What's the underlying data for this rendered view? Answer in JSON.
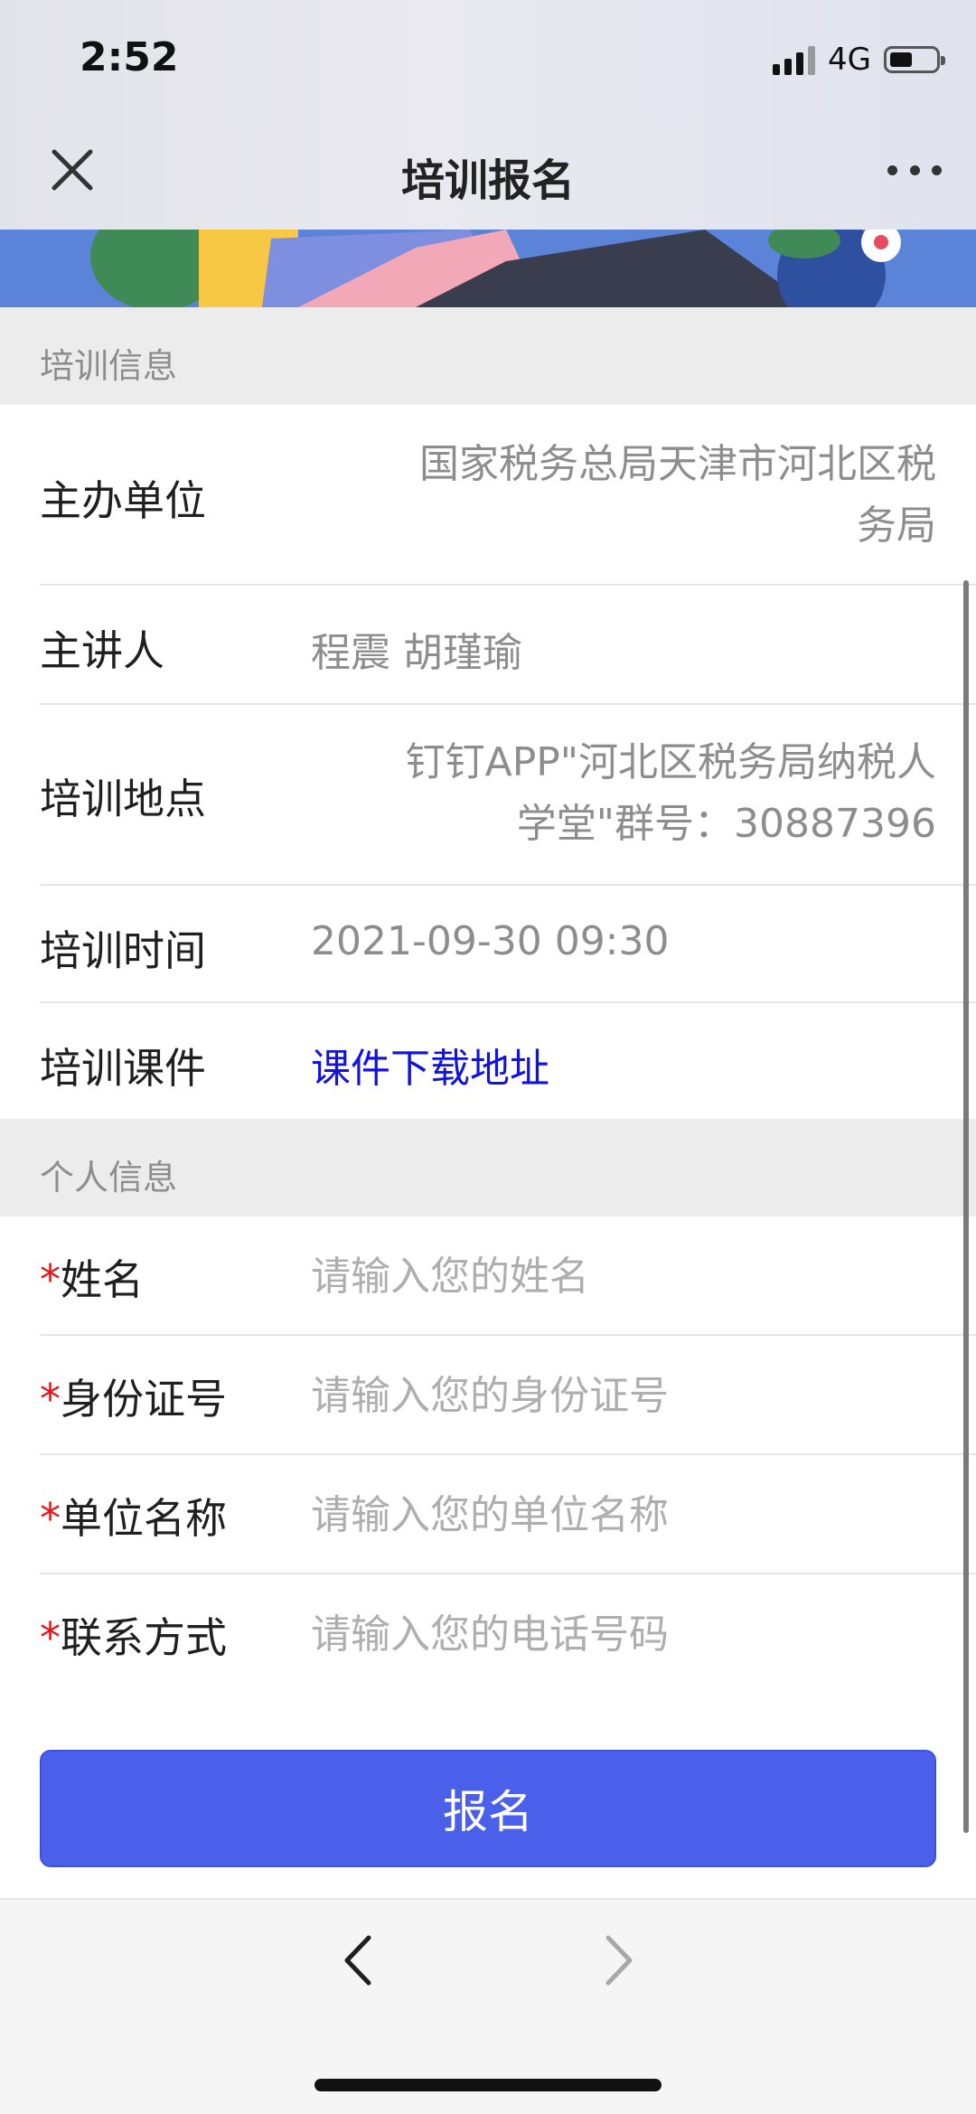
{
  "status_bar": {
    "time": "2:52",
    "network": "4G"
  },
  "nav": {
    "title": "培训报名",
    "close_icon": "close-icon",
    "more_icon": "more-icon"
  },
  "training_info": {
    "header": "培训信息",
    "organizer": {
      "label": "主办单位",
      "value_line1": "国家税务总局天津市河北区税",
      "value_line2": "务局"
    },
    "speaker": {
      "label": "主讲人",
      "value": "程震 胡瑾瑜"
    },
    "location": {
      "label": "培训地点",
      "value_line1": "钉钉APP\"河北区税务局纳税人",
      "value_line2": "学堂\"群号：30887396"
    },
    "time": {
      "label": "培训时间",
      "value": "2021-09-30 09:30"
    },
    "courseware": {
      "label": "培训课件",
      "link": "课件下载地址"
    }
  },
  "personal_info": {
    "header": "个人信息",
    "required_mark": "*",
    "name": {
      "label": "姓名",
      "placeholder": "请输入您的姓名"
    },
    "id_number": {
      "label": "身份证号",
      "placeholder": "请输入您的身份证号"
    },
    "company": {
      "label": "单位名称",
      "placeholder": "请输入您的单位名称"
    },
    "contact": {
      "label": "联系方式",
      "placeholder": "请输入您的电话号码"
    }
  },
  "submit": {
    "label": "报名"
  },
  "toolbar": {
    "back_icon": "chevron-left-icon",
    "forward_icon": "chevron-right-icon"
  },
  "colors": {
    "primary": "#4a5fea",
    "link": "#1313e0",
    "required": "#e01818",
    "section_bg": "#ececec"
  }
}
